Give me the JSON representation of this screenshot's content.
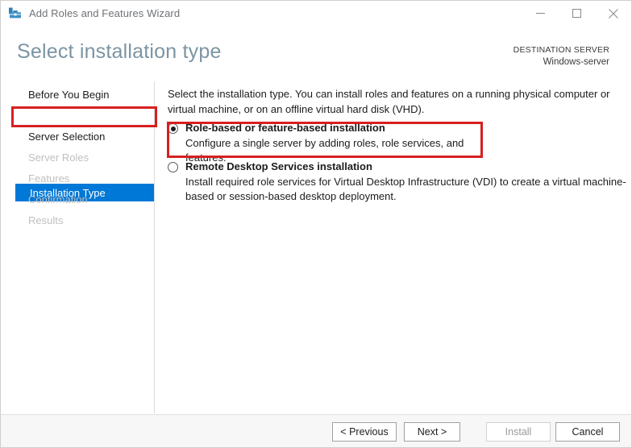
{
  "window": {
    "title": "Add Roles and Features Wizard",
    "icon": "server-tools-icon",
    "controls": {
      "minimize": "minimize-icon",
      "maximize": "maximize-icon",
      "close": "close-icon"
    }
  },
  "header": {
    "page_title": "Select installation type",
    "destination_label": "DESTINATION SERVER",
    "destination_value": "Windows-server"
  },
  "sidebar": {
    "items": [
      {
        "label": "Before You Begin",
        "state": "enabled"
      },
      {
        "label": "Installation Type",
        "state": "selected"
      },
      {
        "label": "Server Selection",
        "state": "enabled"
      },
      {
        "label": "Server Roles",
        "state": "disabled"
      },
      {
        "label": "Features",
        "state": "disabled"
      },
      {
        "label": "Confirmation",
        "state": "disabled"
      },
      {
        "label": "Results",
        "state": "disabled"
      }
    ]
  },
  "main": {
    "intro": "Select the installation type. You can install roles and features on a running physical computer or virtual machine, or on an offline virtual hard disk (VHD).",
    "options": [
      {
        "label": "Role-based or feature-based installation",
        "description": "Configure a single server by adding roles, role services, and features.",
        "selected": true
      },
      {
        "label": "Remote Desktop Services installation",
        "description": "Install required role services for Virtual Desktop Infrastructure (VDI) to create a virtual machine-based or session-based desktop deployment.",
        "selected": false
      }
    ]
  },
  "footer": {
    "previous": "< Previous",
    "next": "Next >",
    "install": "Install",
    "cancel": "Cancel"
  },
  "annotations": {
    "highlight_color": "#d62020",
    "targets": [
      "Installation Type",
      "Role-based or feature-based installation",
      "Next >"
    ]
  },
  "colors": {
    "accent": "#0078d7",
    "title_text": "#7b94a3",
    "window_bg": "#ffffff",
    "footer_bg": "#f7f7f7",
    "disabled_text": "#c0c0c0"
  }
}
